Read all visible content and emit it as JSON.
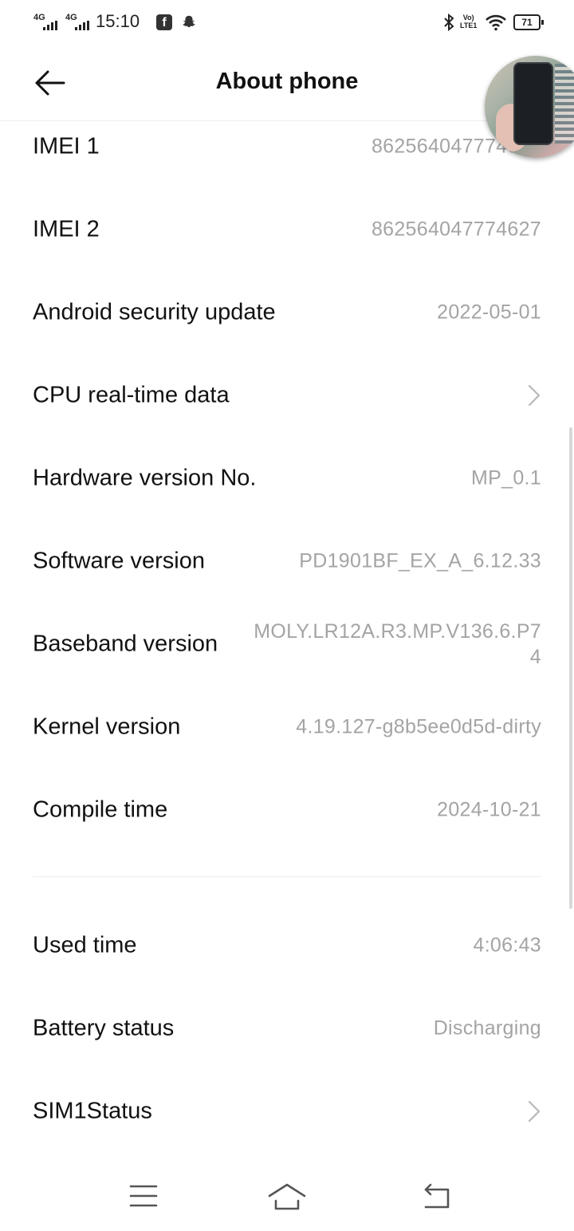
{
  "status_bar": {
    "sim1_network": "4G",
    "sim2_network": "4G",
    "time": "15:10",
    "volte_line1": "Vo)",
    "volte_line2": "LTE1",
    "battery_level": "71"
  },
  "header": {
    "title": "About phone"
  },
  "rows": [
    {
      "label": "IMEI 1",
      "value": "862564047774619"
    },
    {
      "label": "IMEI 2",
      "value": "862564047774627"
    },
    {
      "label": "Android security update",
      "value": "2022-05-01"
    },
    {
      "label": "CPU real-time data",
      "value": ""
    },
    {
      "label": "Hardware version No.",
      "value": "MP_0.1"
    },
    {
      "label": "Software version",
      "value": "PD1901BF_EX_A_6.12.33"
    },
    {
      "label": "Baseband version",
      "value": "MOLY.LR12A.R3.MP.V136.6.P74"
    },
    {
      "label": "Kernel version",
      "value": "4.19.127-g8b5ee0d5d-dirty"
    },
    {
      "label": "Compile time",
      "value": "2024-10-21"
    },
    {
      "label": "Used time",
      "value": "4:06:43"
    },
    {
      "label": "Battery status",
      "value": "Discharging"
    },
    {
      "label": "SIM1Status",
      "value": ""
    }
  ],
  "colors": {
    "label_text": "#111111",
    "value_text": "#a4a4a4",
    "divider": "#eeeeee"
  },
  "icons": {
    "back": "arrow-left-icon",
    "chevron": "chevron-right-icon",
    "nav_menu": "menu-icon",
    "nav_home": "home-icon",
    "nav_back": "return-icon"
  }
}
